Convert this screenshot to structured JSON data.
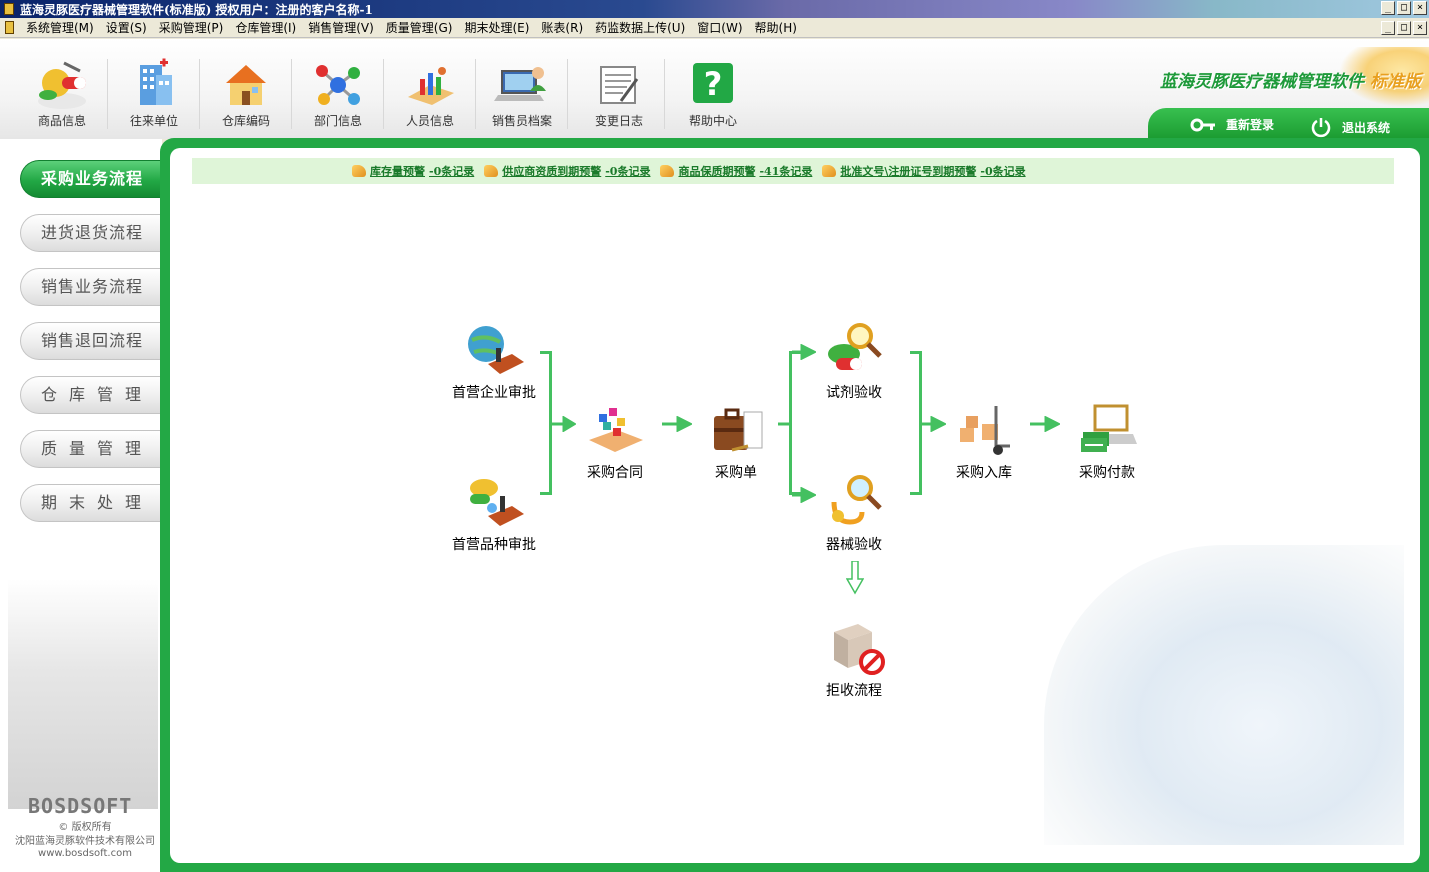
{
  "window": {
    "title": "蓝海灵豚医疗器械管理软件(标准版)  授权用户：注册的客户名称-1",
    "controls": [
      "_",
      "□",
      "×"
    ]
  },
  "menu": {
    "items": [
      "系统管理(M)",
      "设置(S)",
      "采购管理(P)",
      "仓库管理(I)",
      "销售管理(V)",
      "质量管理(G)",
      "期末处理(E)",
      "账表(R)",
      "药监数据上传(U)",
      "窗口(W)",
      "帮助(H)"
    ]
  },
  "toolbar": {
    "items": [
      {
        "label": "商品信息",
        "icon": "pills-icon"
      },
      {
        "label": "往来单位",
        "icon": "hospital-building-icon"
      },
      {
        "label": "仓库编码",
        "icon": "warehouse-house-icon"
      },
      {
        "label": "部门信息",
        "icon": "molecule-icon"
      },
      {
        "label": "人员信息",
        "icon": "chart-people-icon"
      },
      {
        "label": "销售员档案",
        "icon": "laptop-user-icon"
      },
      {
        "label": "变更日志",
        "icon": "notepad-icon"
      },
      {
        "label": "帮助中心",
        "icon": "question-icon"
      }
    ]
  },
  "brand": {
    "name": "蓝海灵豚医疗器械管理软件",
    "edition": "标准版"
  },
  "account": {
    "relogin": "重新登录",
    "exit": "退出系统"
  },
  "sidebar": {
    "items": [
      {
        "label": "采购业务流程",
        "active": true
      },
      {
        "label": "进货退货流程",
        "active": false
      },
      {
        "label": "销售业务流程",
        "active": false
      },
      {
        "label": "销售退回流程",
        "active": false
      },
      {
        "label": "仓库管理",
        "active": false
      },
      {
        "label": "质量管理",
        "active": false
      },
      {
        "label": "期末处理",
        "active": false
      }
    ],
    "logo": "BOSDSOFT",
    "copyright": "© 版权所有",
    "company": "沈阳蓝海灵豚软件技术有限公司",
    "website": "www.bosdsoft.com"
  },
  "alerts": [
    {
      "label": "库存量预警",
      "count": "-0条记录"
    },
    {
      "label": "供应商资质到期预警",
      "count": "-0条记录"
    },
    {
      "label": "商品保质期预警",
      "count": "-41条记录"
    },
    {
      "label": "批准文号\\注册证号到期预警",
      "count": "-0条记录"
    }
  ],
  "flow": {
    "nodes": {
      "enterprise_approval": "首营企业审批",
      "variety_approval": "首营品种审批",
      "contract": "采购合同",
      "order": "采购单",
      "reagent_check": "试剂验收",
      "device_check": "器械验收",
      "stock_in": "采购入库",
      "payment": "采购付款",
      "reject": "拒收流程"
    }
  },
  "colors": {
    "accent_green": "#23a845",
    "alert_bg": "#dff5d8",
    "arrow_green": "#44c060"
  }
}
